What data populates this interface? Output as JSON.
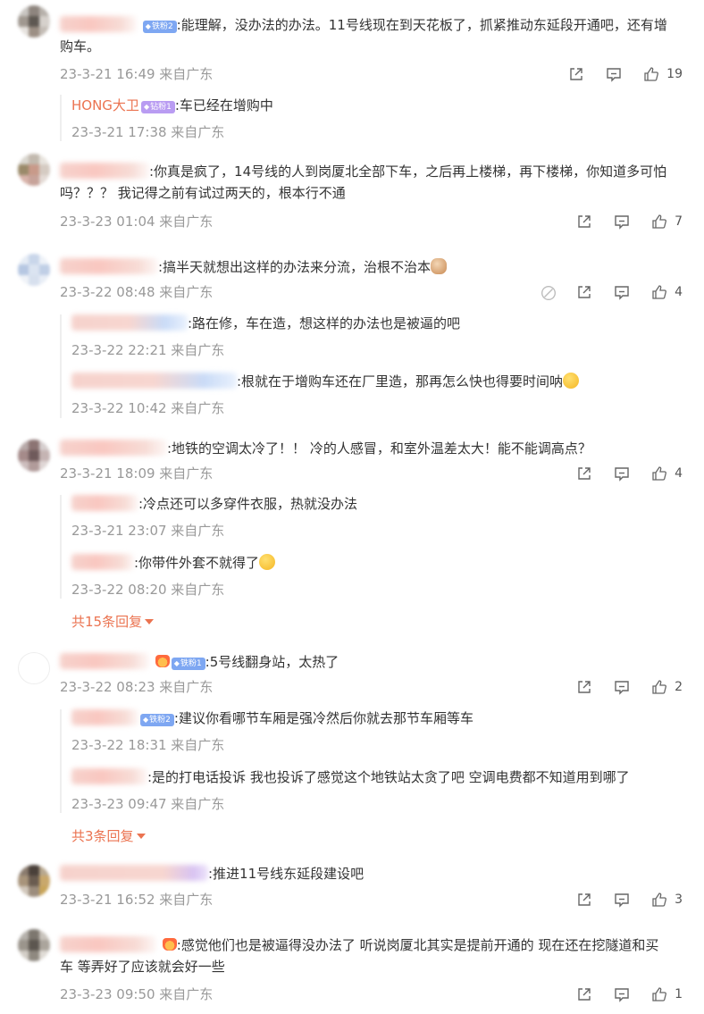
{
  "comments": [
    {
      "badge": "铁粉2",
      "text": ":能理解，没办法的办法。11号线现在到天花板了，抓紧推动东延段开通吧，还有增购车。",
      "meta": "23-3-21 16:49 来自广东",
      "likes": "19",
      "replies": [
        {
          "user": "HONG大卫",
          "badge": "钻粉1",
          "text": ":车已经在增购中",
          "meta": "23-3-21 17:38 来自广东"
        }
      ]
    },
    {
      "text": ":你真是疯了，14号线的人到岗厦北全部下车，之后再上楼梯，再下楼梯，你知道多可怕吗？？？ 我记得之前有试过两天的，根本行不通",
      "meta": "23-3-23 01:04 来自广东",
      "likes": "7"
    },
    {
      "text": ":搞半天就想出这样的办法来分流，治根不治本",
      "meta": "23-3-22 08:48 来自广东",
      "likes": "4",
      "replies": [
        {
          "text": ":路在修，车在造，想这样的办法也是被逼的吧",
          "meta": "23-3-22 22:21 来自广东"
        },
        {
          "text": ":根就在于增购车还在厂里造，那再怎么快也得要时间呐",
          "meta": "23-3-22 10:42 来自广东"
        }
      ]
    },
    {
      "text": ":地铁的空调太冷了！！ 冷的人感冒，和室外温差太大！能不能调高点？",
      "meta": "23-3-21 18:09 来自广东",
      "likes": "4",
      "replies": [
        {
          "text": ":冷点还可以多穿件衣服，热就没办法",
          "meta": "23-3-21 23:07 来自广东"
        },
        {
          "text": ":你带件外套不就得了",
          "meta": "23-3-22 08:20 来自广东"
        }
      ],
      "more": "共15条回复"
    },
    {
      "badge": "铁粉1",
      "text": ":5号线翻身站，太热了",
      "meta": "23-3-22 08:23 来自广东",
      "likes": "2",
      "replies": [
        {
          "badge": "铁粉2",
          "text": ":建议你看哪节车厢是强冷然后你就去那节车厢等车",
          "meta": "23-3-22 18:31 来自广东"
        },
        {
          "text": ":是的打电话投诉 我也投诉了感觉这个地铁站太贪了吧 空调电费都不知道用到哪了",
          "meta": "23-3-23 09:47 来自广东"
        }
      ],
      "more": "共3条回复"
    },
    {
      "text": ":推进11号线东延段建设吧",
      "meta": "23-3-21 16:52 来自广东",
      "likes": "3"
    },
    {
      "text": ":感觉他们也是被逼得没办法了 听说岗厦北其实是提前开通的 现在还在挖隧道和买车 等弄好了应该就会好一些",
      "meta": "23-3-23 09:50 来自广东",
      "likes": "1"
    }
  ],
  "colors": {
    "accent": "#eb7350",
    "meta": "#999999",
    "text": "#333333"
  },
  "icons": [
    "share-icon",
    "comment-icon",
    "like-icon",
    "report-icon"
  ]
}
